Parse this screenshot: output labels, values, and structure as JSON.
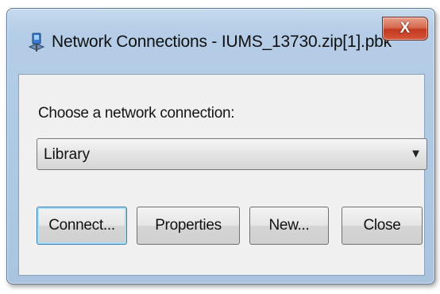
{
  "window": {
    "title": "Network Connections - IUMS_13730.zip[1].pbk",
    "close_glyph": "X",
    "icon": "network-connection-icon"
  },
  "main": {
    "prompt": "Choose a network connection:",
    "connection": {
      "selected": "Library",
      "arrow": "▼"
    }
  },
  "buttons": {
    "connect": "Connect...",
    "properties": "Properties",
    "new": "New...",
    "close": "Close"
  }
}
